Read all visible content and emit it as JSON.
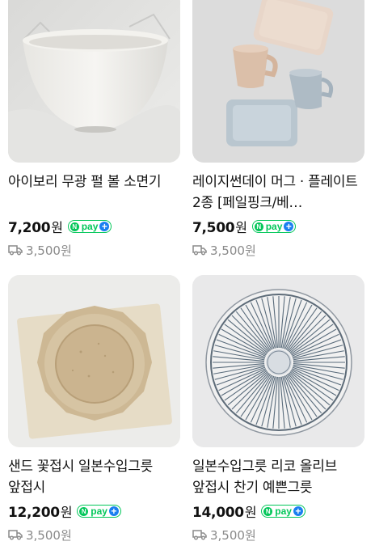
{
  "products": [
    {
      "title": "아이보리 무광 펄 볼 소면기",
      "price": "7,200",
      "currency": "원",
      "npay_label": "pay",
      "npay_plus": "+",
      "shipping": "3,500원",
      "image": "white-bowl"
    },
    {
      "title": "레이지썬데이 머그 · 플레이트 2종 [페일핑크/베…",
      "price": "7,500",
      "currency": "원",
      "npay_label": "pay",
      "npay_plus": "+",
      "shipping": "3,500원",
      "image": "mugs-plates"
    },
    {
      "title": "샌드 꽃접시 일본수입그릇 앞접시",
      "price": "12,200",
      "currency": "원",
      "npay_label": "pay",
      "npay_plus": "+",
      "shipping": "3,500원",
      "image": "sand-flower-plate"
    },
    {
      "title": "일본수입그릇 리코 올리브 앞접시 찬기 예쁜그릇",
      "price": "14,000",
      "currency": "원",
      "npay_label": "pay",
      "npay_plus": "+",
      "shipping": "3,500원",
      "image": "striped-plate"
    }
  ],
  "colors": {
    "npay_green": "#03c75a",
    "npay_plus_blue": "#1a7ff0",
    "muted_text": "#8a8a8a"
  }
}
